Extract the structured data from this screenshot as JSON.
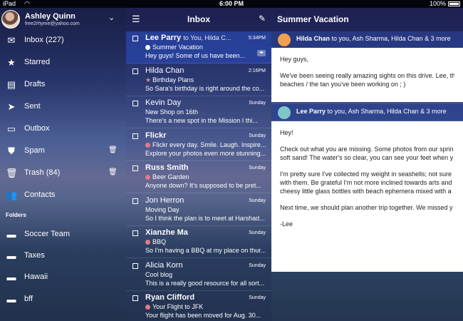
{
  "status": {
    "carrier": "iPad",
    "time": "6:00 PM",
    "battery": "100%"
  },
  "profile": {
    "name": "Ashley Quinn",
    "email": "free2rhyme@yahoo.com"
  },
  "nav": [
    {
      "label": "Inbox (227)",
      "icon": "envelope-icon"
    },
    {
      "label": "Starred",
      "icon": "star-icon"
    },
    {
      "label": "Drafts",
      "icon": "draft-icon"
    },
    {
      "label": "Sent",
      "icon": "paper-plane-icon"
    },
    {
      "label": "Outbox",
      "icon": "outbox-tray-icon"
    },
    {
      "label": "Spam",
      "icon": "shield-icon"
    },
    {
      "label": "Trash (84)",
      "icon": "trash-icon"
    },
    {
      "label": "Contacts",
      "icon": "contacts-icon"
    }
  ],
  "folders_header": "Folders",
  "folders": [
    "Soccer Team",
    "Taxes",
    "Hawaii",
    "bff"
  ],
  "list": {
    "title": "Inbox",
    "messages": [
      {
        "from": "Lee Parry",
        "to": "to You, Hilda C...",
        "time": "5:34PM",
        "subject": "Summer Vacation",
        "preview": "Hey guys!  Some of us have been...",
        "unread": true,
        "selected": true,
        "dot": "#ffffff",
        "star": false
      },
      {
        "from": "Hilda Chan",
        "to": "",
        "time": "2:16PM",
        "subject": "Birthday Plans",
        "preview": "So Sara's birthday is right around the co...",
        "unread": false,
        "selected": false,
        "dot": "",
        "star": true
      },
      {
        "from": "Kevin Day",
        "to": "",
        "time": "Sunday",
        "subject": "New Shop on 16th",
        "preview": "There's a new spot in the Mission I thi...",
        "unread": false,
        "selected": false,
        "dot": "",
        "star": false
      },
      {
        "from": "Flickr",
        "to": "",
        "time": "Sunday",
        "subject": "Flickr every day. Smile. Laugh. Inspire...",
        "preview": "Explore your photos even more stunning...",
        "unread": true,
        "selected": false,
        "dot": "#e07b8a",
        "star": false
      },
      {
        "from": "Russ Smith",
        "to": "",
        "time": "Sunday",
        "subject": "Beer Garden",
        "preview": "Anyone down? It's supposed to be pret...",
        "unread": true,
        "selected": false,
        "dot": "#e07b8a",
        "star": false
      },
      {
        "from": "Jon Herron",
        "to": "",
        "time": "Sunday",
        "subject": "Moving Day",
        "preview": "So I think the plan is to meet at Harshad...",
        "unread": false,
        "selected": false,
        "dot": "",
        "star": false
      },
      {
        "from": "Xianzhe Ma",
        "to": "",
        "time": "Sunday",
        "subject": "BBQ",
        "preview": "So I'm having a BBQ at my place on thur...",
        "unread": true,
        "selected": false,
        "dot": "#e07b8a",
        "star": false
      },
      {
        "from": "Alicia Korn",
        "to": "",
        "time": "Sunday",
        "subject": "Cool blog",
        "preview": "This is a really good resource for all sort...",
        "unread": false,
        "selected": false,
        "dot": "",
        "star": false
      },
      {
        "from": "Ryan Clifford",
        "to": "",
        "time": "Sunday",
        "subject": "Your Flight to JFK",
        "preview": "Your flight has been moved for Aug. 30...",
        "unread": true,
        "selected": false,
        "dot": "#e07b8a",
        "star": false
      }
    ]
  },
  "reader": {
    "title": "Summer Vacation",
    "m1_from": "Hilda Chan",
    "m1_to": "to you, Ash Sharma, Hilda Chan & 3 more",
    "m1_p1": "Hey guys,",
    "m1_p2": "We've been seeing really amazing sights on this drive. Lee, this is",
    "m1_p3": "beaches / the tan you've been working on ; )",
    "m2_from": "Lee Parry",
    "m2_to": "to you, Ash Sharma, Hilda Chan & 3 more",
    "m2_p1": "Hey!",
    "m2_p2a": "Check out what you are missing. Some photos from our sprin",
    "m2_p2b": "soft sand! The water's so clear, you can see your feet when y",
    "m2_p3a": "I'm pretty sure I've collected my weight in seashells; not sure",
    "m2_p3b": "with them. Be grateful I'm not more inclined towards arts and",
    "m2_p3c": "cheesy little glass bottles with beach ephemera mixed with a",
    "m2_p4": "Next time, we should plan another trip together. We missed y",
    "m2_p5": "-Lee"
  },
  "colors": {
    "selected": "#2f4aa8",
    "dot": "#e07b8a",
    "avatar1": "#f0a050",
    "avatar2": "#7ec7c9"
  }
}
